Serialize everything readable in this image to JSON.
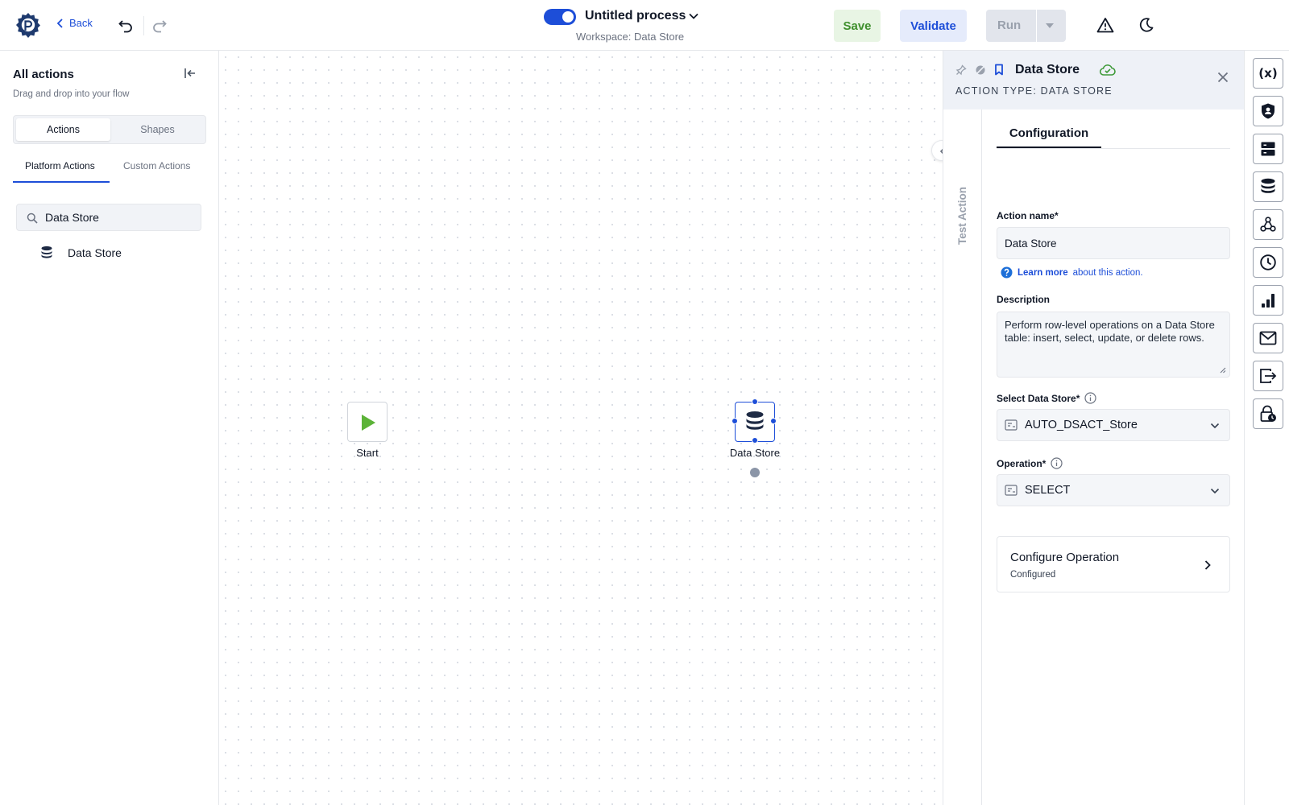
{
  "header": {
    "back_label": "Back",
    "process_title": "Untitled process",
    "workspace": "Workspace: Data Store",
    "save_label": "Save",
    "validate_label": "Validate",
    "run_label": "Run",
    "process_enabled": true
  },
  "left_panel": {
    "title": "All actions",
    "subtitle": "Drag and drop into your flow",
    "segments": [
      "Actions",
      "Shapes"
    ],
    "active_segment": "Actions",
    "tabs": [
      "Platform Actions",
      "Custom Actions"
    ],
    "active_tab": "Platform Actions",
    "search_value": "Data Store",
    "results": [
      {
        "label": "Data Store",
        "icon": "database-icon"
      }
    ]
  },
  "canvas": {
    "nodes": [
      {
        "id": "start",
        "label": "Start",
        "icon": "play-icon"
      },
      {
        "id": "data-store",
        "label": "Data Store",
        "icon": "database-icon",
        "selected": true
      }
    ]
  },
  "config_panel": {
    "title": "Data Store",
    "action_type": "ACTION TYPE: DATA STORE",
    "side_tab": "Test Action",
    "tab": "Configuration",
    "action_name_label": "Action name*",
    "action_name_value": "Data Store",
    "learn_more": "Learn more",
    "learn_about": "about this action.",
    "description_label": "Description",
    "description_value": "Perform row-level operations on a Data Store table: insert, select, update, or delete rows.",
    "select_store_label": "Select Data Store*",
    "select_store_value": "AUTO_DSACT_Store",
    "operation_label": "Operation*",
    "operation_value": "SELECT",
    "configure_title": "Configure Operation",
    "configure_status": "Configured"
  },
  "right_rail": {
    "items": [
      "variables-icon",
      "shield-icon",
      "server-icon",
      "database-icon",
      "webhook-icon",
      "clock-icon",
      "chart-icon",
      "mail-icon",
      "export-icon",
      "lock-clock-icon"
    ]
  },
  "colors": {
    "accent": "#1d4ed8",
    "save_green": "#3f8f2d",
    "start_green": "#5cb338"
  }
}
